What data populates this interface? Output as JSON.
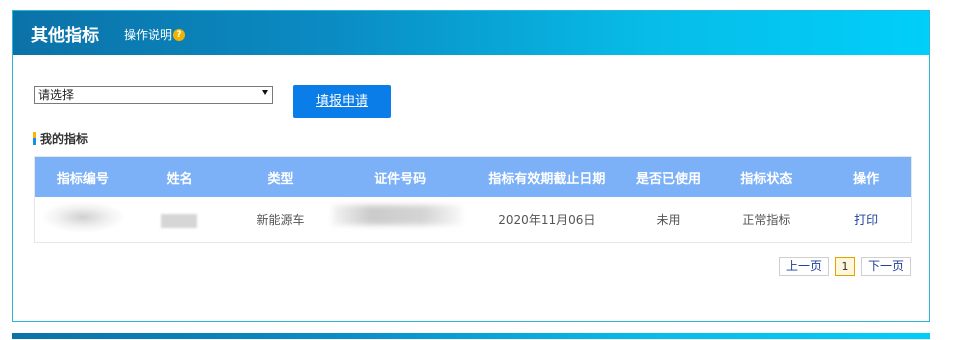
{
  "header": {
    "title": "其他指标",
    "help_label": "操作说明",
    "help_icon": "question-circle-icon"
  },
  "form": {
    "select_value": "请选择",
    "apply_label": "填报申请"
  },
  "section": {
    "title": "我的指标"
  },
  "table": {
    "columns": [
      "指标编号",
      "姓名",
      "类型",
      "证件号码",
      "指标有效期截止日期",
      "是否已使用",
      "指标状态",
      "操作"
    ],
    "rows": [
      {
        "id": "",
        "name": "",
        "type": "新能源车",
        "id_number": "",
        "expiry": "2020年11月06日",
        "used": "未用",
        "status": "正常指标",
        "action": "打印"
      }
    ]
  },
  "pagination": {
    "prev_label": "上一页",
    "current_page": "1",
    "next_label": "下一页"
  },
  "colors": {
    "header_gradient_start": "#0b72a8",
    "header_gradient_end": "#00cffa",
    "table_header": "#7cb1f8",
    "apply_button": "#0b7de8",
    "link": "#1e3f9b"
  }
}
